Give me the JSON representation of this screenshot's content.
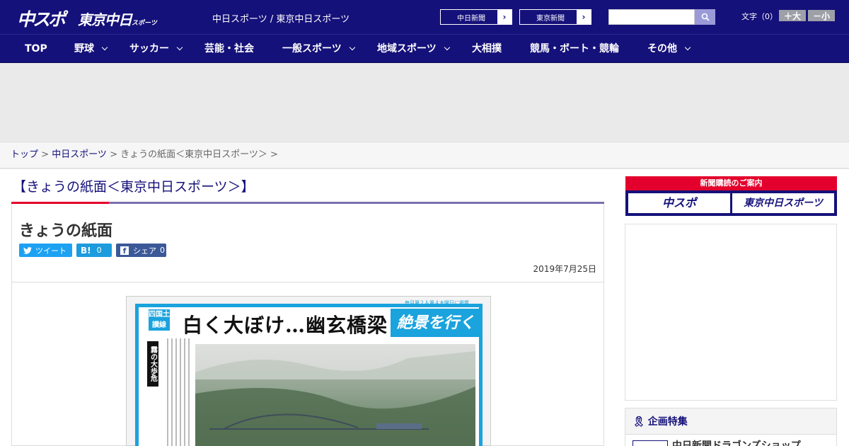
{
  "header": {
    "logo_chuspo": "中スポ",
    "logo_tokyo": "東京中日",
    "logo_tokyo_small": "スポーツ",
    "site_links": "中日スポーツ / 東京中日スポーツ",
    "btn_chunichi": "中日新聞",
    "btn_tokyo": "東京新聞",
    "search_placeholder": "",
    "fontsize_label": "文字（0）",
    "font_large": "＋大",
    "font_small": "－小"
  },
  "nav": {
    "items": [
      "TOP",
      "野球",
      "サッカー",
      "芸能・社会",
      "一般スポーツ",
      "地域スポーツ",
      "大相撲",
      "競馬・ボート・競輪",
      "その他"
    ]
  },
  "breadcrumb": {
    "top": "トップ",
    "chunichi": "中日スポーツ",
    "current": "きょうの紙面＜東京中日スポーツ＞",
    "sep": " > "
  },
  "section_title": "【きょうの紙面＜東京中日スポーツ＞】",
  "article": {
    "title": "きょうの紙面",
    "tweet_label": "ツイート",
    "hatena_label": "B!",
    "hatena_count": "0",
    "fb_label": "シェア",
    "fb_count": "0",
    "date": "2019年7月25日"
  },
  "paper": {
    "headline": "白く大ぼけ…幽玄橋梁",
    "tag": "四国土讃線",
    "banner": "絶景を行く",
    "small": "毎月第２＆第４木曜日に掲載",
    "vert": "霧の大歩危"
  },
  "sidebar": {
    "banner_top": "新聞購読のご案内",
    "banner_left": "中スポ",
    "banner_right": "東京中日スポーツ",
    "kikaku_head": "企画特集",
    "kikaku_item": "中日新聞ドラゴンズショップ"
  },
  "colors": {
    "brand_navy": "#15117a",
    "accent_red": "#e3002c",
    "twitter": "#1da1f2",
    "hatena": "#1d9bdd",
    "facebook": "#3b5998"
  }
}
